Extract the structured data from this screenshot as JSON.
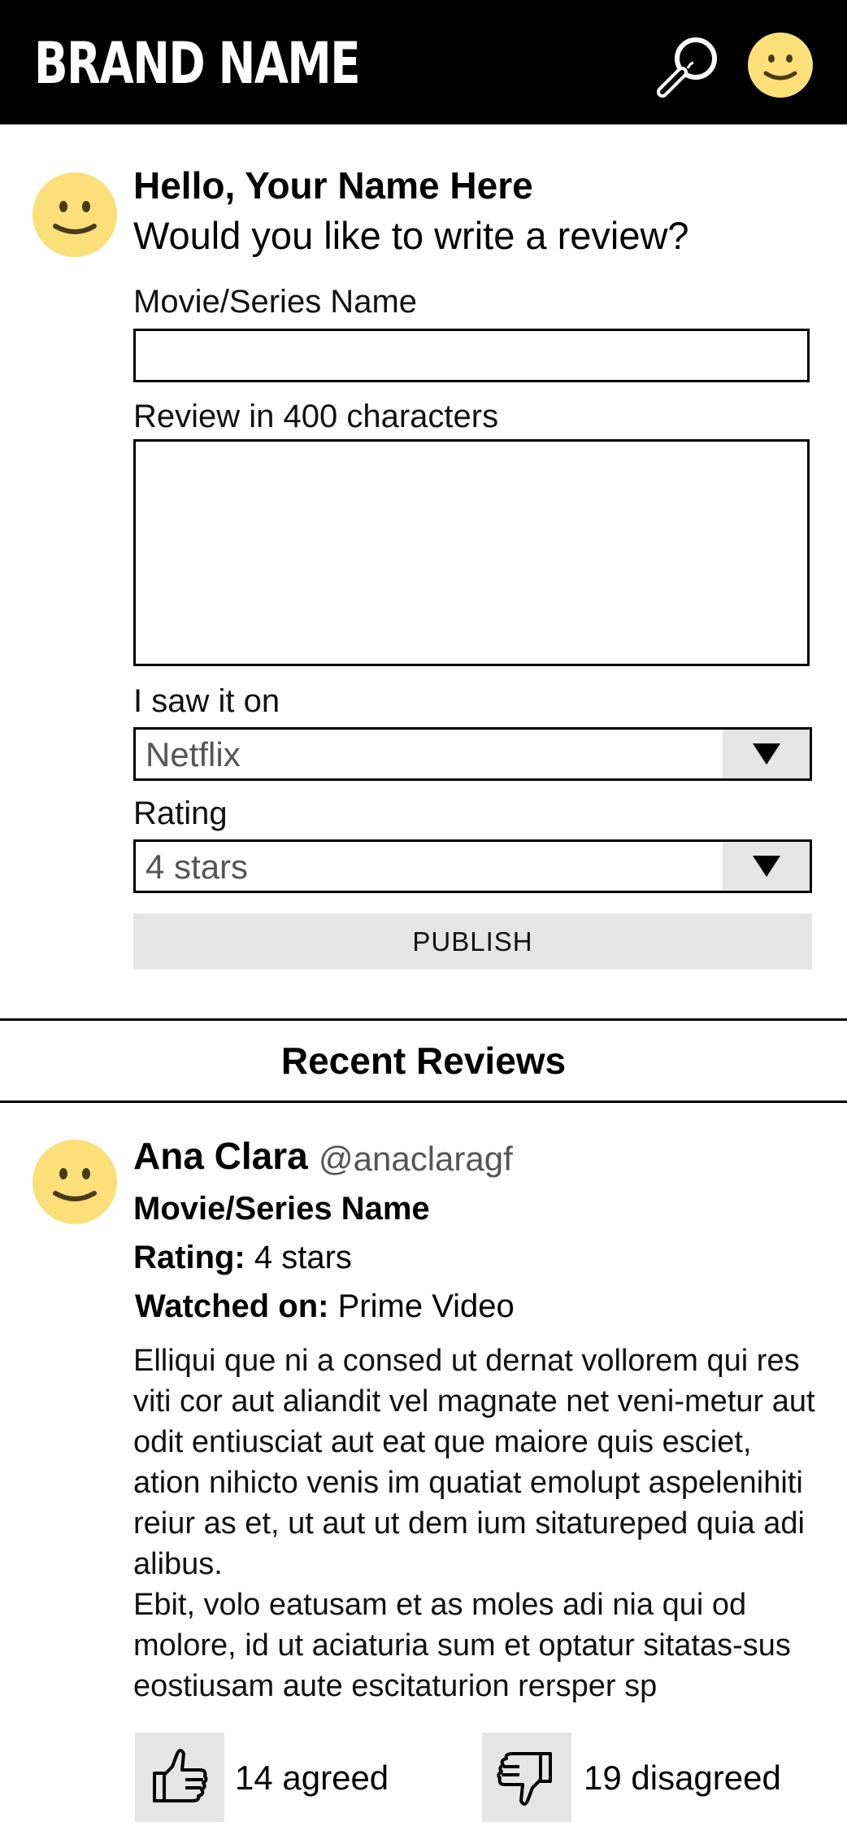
{
  "header": {
    "brand": "BRAND NAME",
    "search_icon": "search-icon",
    "avatar_icon": "smiley-avatar-icon"
  },
  "compose": {
    "greeting": "Hello, Your Name Here",
    "question": "Would you like to write a review?",
    "title_label": "Movie/Series Name",
    "title_value": "",
    "review_label": "Review in 400 characters",
    "review_value": "",
    "platform_label": "I saw it on",
    "platform_value": "Netflix",
    "rating_label": "Rating",
    "rating_value": "4 stars",
    "publish_label": "PUBLISH"
  },
  "recent": {
    "title": "Recent Reviews",
    "reviews": [
      {
        "name": "Ana Clara",
        "handle": "@anaclaragf",
        "title": "Movie/Series Name",
        "rating_label": "Rating:",
        "rating": "4 stars",
        "watched_label": "Watched on:",
        "watched": "Prime Video",
        "body": "Elliqui que ni a consed ut dernat vollorem qui res viti cor aut aliandit vel magnate net veni-metur aut odit entiusciat aut eat que maiore quis esciet, ation nihicto venis im quatiat emolupt aspelenihiti reiur as et, ut aut ut dem ium sitatureped quia adi alibus.\nEbit, volo eatusam et as moles adi nia qui od molore, id ut aciaturia sum et optatur sitatas-sus eostiusam aute escitaturion rersper sp",
        "agreed": "14 agreed",
        "disagreed": "19 disagreed"
      }
    ]
  },
  "colors": {
    "header_bg": "#000000",
    "avatar_yellow": "#FBE07A",
    "button_gray": "#E5E5E5"
  }
}
